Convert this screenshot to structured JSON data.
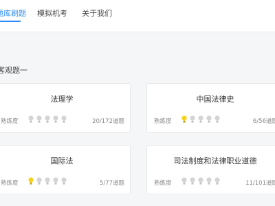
{
  "nav": {
    "tabs": [
      {
        "label": "题库刷题",
        "active": true
      },
      {
        "label": "模拟机考",
        "active": false
      },
      {
        "label": "关于我们",
        "active": false
      }
    ]
  },
  "section": {
    "title": "客观题一"
  },
  "cards": [
    {
      "title": "法理学",
      "proficiency_label": "熟练度",
      "lit_bulbs": 0,
      "count": "20/172道题"
    },
    {
      "title": "中国法律史",
      "proficiency_label": "熟练度",
      "lit_bulbs": 1,
      "count": "6/56道题"
    },
    {
      "title": "国际法",
      "proficiency_label": "熟练度",
      "lit_bulbs": 1,
      "count": "5/77道题"
    },
    {
      "title": "司法制度和法律职业道德",
      "proficiency_label": "熟练度",
      "lit_bulbs": 0,
      "count": "11/101道题"
    }
  ],
  "colors": {
    "accent": "#2d8cf0",
    "bulb_on": "#f7d21b",
    "bulb_off": "#d4d4d4"
  }
}
